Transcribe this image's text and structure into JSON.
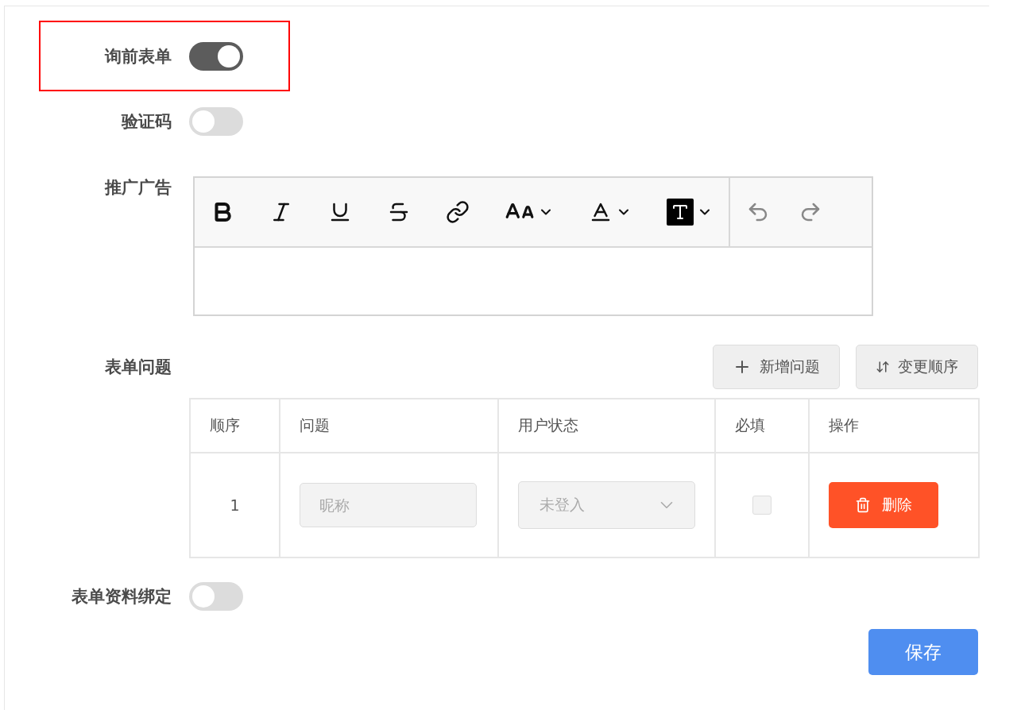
{
  "settings": [
    {
      "label": "询前表单",
      "on": true,
      "highlighted": true
    },
    {
      "label": "验证码",
      "on": false,
      "highlighted": false
    }
  ],
  "promo": {
    "label": "推广广告",
    "toolbar": [
      {
        "kind": "bold",
        "has_menu": false
      },
      {
        "kind": "italic",
        "has_menu": false
      },
      {
        "kind": "underline",
        "has_menu": false
      },
      {
        "kind": "strike",
        "has_menu": false
      },
      {
        "kind": "link",
        "has_menu": false
      },
      {
        "kind": "size",
        "has_menu": true
      },
      {
        "kind": "color",
        "has_menu": true
      },
      {
        "kind": "background",
        "has_menu": true
      },
      {
        "kind": "divider"
      },
      {
        "kind": "undo",
        "has_menu": false
      },
      {
        "kind": "redo",
        "has_menu": false
      }
    ]
  },
  "questions": {
    "label": "表单问题",
    "buttons": [
      {
        "label": "新增问题",
        "kind": "add"
      },
      {
        "label": "变更顺序",
        "kind": "sort"
      }
    ],
    "table": {
      "columns": [
        "顺序",
        "问题",
        "用户状态",
        "必填",
        "操作"
      ],
      "rows": [
        {
          "order": "1",
          "question": {
            "placeholder": "昵称",
            "disabled": true
          },
          "status": {
            "value": "未登入",
            "disabled": true
          },
          "required": {
            "checked": false,
            "disabled": true
          },
          "action": {
            "label": "删除"
          }
        }
      ]
    }
  },
  "binding": {
    "label": "表单资料绑定",
    "on": false
  },
  "save": {
    "label": "保存"
  }
}
